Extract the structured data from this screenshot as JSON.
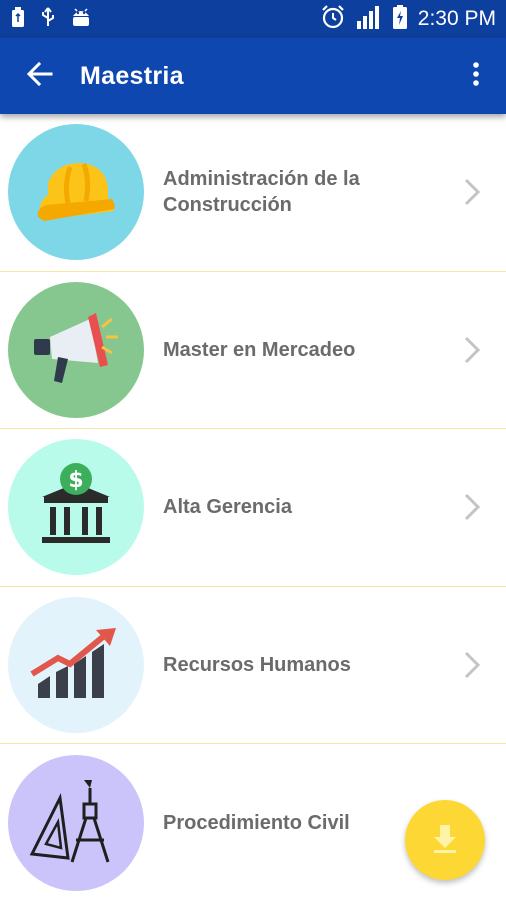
{
  "status_bar": {
    "time": "2:30 PM",
    "icons": [
      "usb-icon",
      "usb-debug-icon",
      "android-icon",
      "alarm-icon",
      "signal-icon",
      "battery-charging-icon"
    ]
  },
  "app_bar": {
    "title": "Maestria",
    "back_icon": "arrow-back-icon",
    "menu_icon": "more-vert-icon",
    "color": "#0f47b0"
  },
  "list": {
    "items": [
      {
        "label": "Administración de la Construcción",
        "icon": "hard-hat-icon",
        "circle_color": "#7ed7e6",
        "has_chevron": true
      },
      {
        "label": "Master en Mercadeo",
        "icon": "megaphone-icon",
        "circle_color": "#86c78f",
        "has_chevron": true
      },
      {
        "label": "Alta Gerencia",
        "icon": "bank-dollar-icon",
        "circle_color": "#b8fbea",
        "has_chevron": true
      },
      {
        "label": "Recursos Humanos",
        "icon": "growth-chart-icon",
        "circle_color": "#e2f3fb",
        "has_chevron": true
      },
      {
        "label": "Procedimiento Civil",
        "icon": "drafting-tools-icon",
        "circle_color": "#cbc4fb",
        "has_chevron": false
      }
    ]
  },
  "fab": {
    "icon": "download-icon",
    "color": "#fdd835"
  }
}
